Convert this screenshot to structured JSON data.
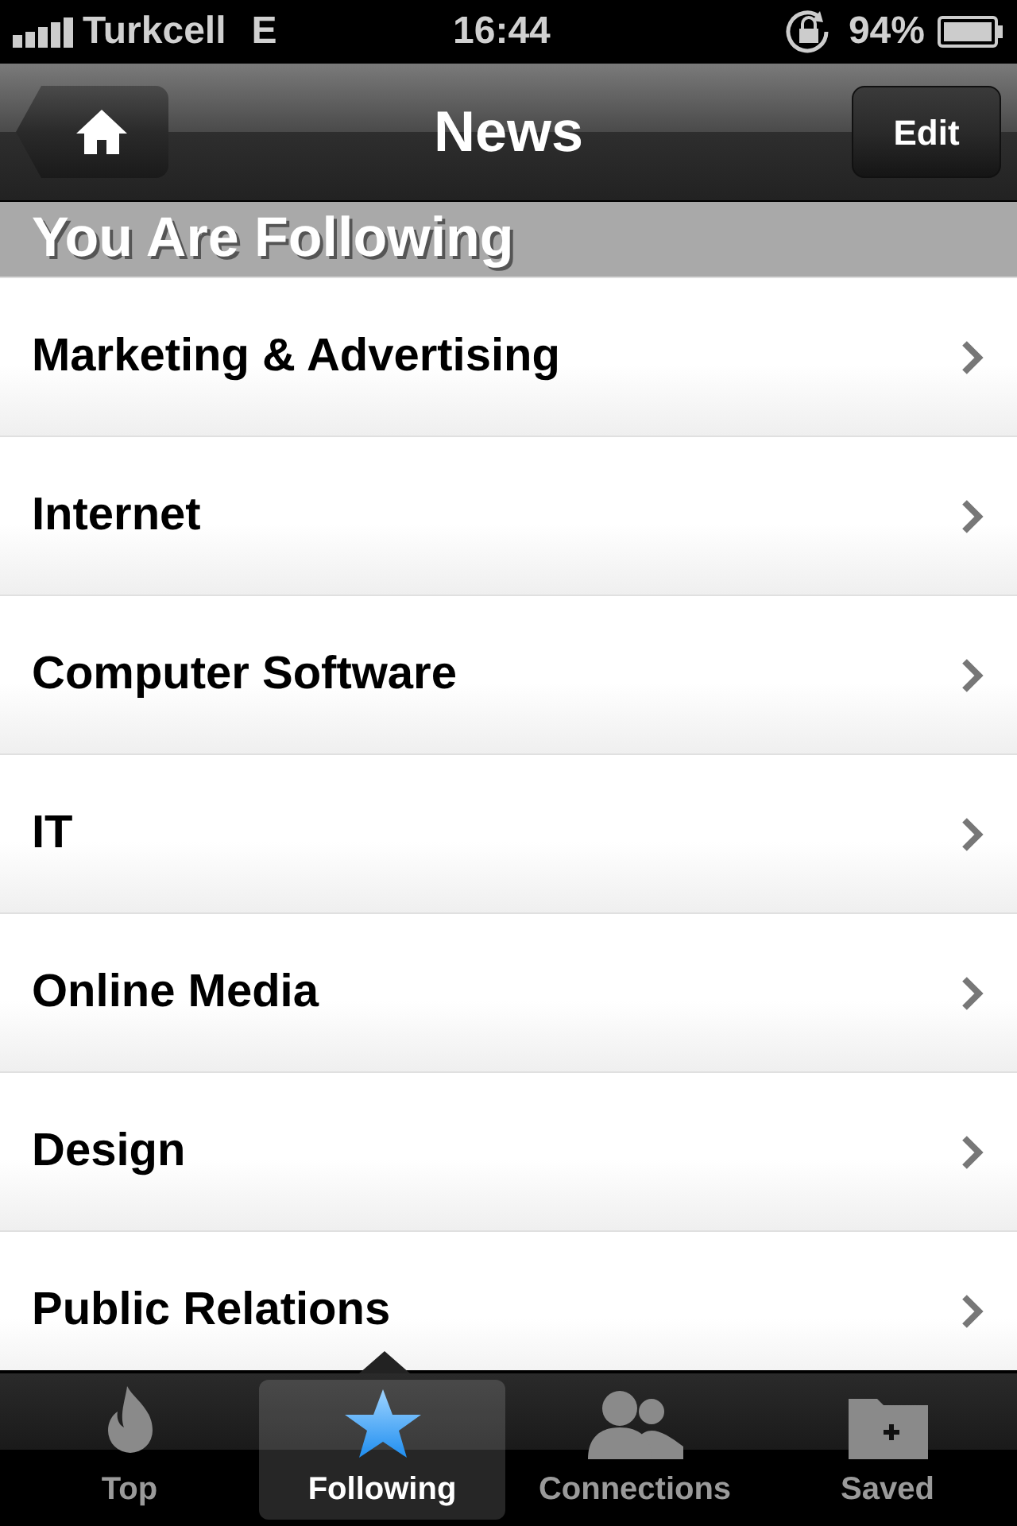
{
  "status_bar": {
    "carrier": "Turkcell",
    "network": "E",
    "time": "16:44",
    "battery": "94%"
  },
  "nav_bar": {
    "title": "News",
    "right_button": "Edit"
  },
  "section_header": "You Are Following",
  "items": [
    {
      "label": "Marketing & Advertising"
    },
    {
      "label": "Internet"
    },
    {
      "label": "Computer Software"
    },
    {
      "label": "IT"
    },
    {
      "label": "Online Media"
    },
    {
      "label": "Design"
    },
    {
      "label": "Public Relations"
    }
  ],
  "tabs": [
    {
      "label": "Top",
      "kind": "flame",
      "selected": false
    },
    {
      "label": "Following",
      "kind": "star",
      "selected": true
    },
    {
      "label": "Connections",
      "kind": "people",
      "selected": false
    },
    {
      "label": "Saved",
      "kind": "folder",
      "selected": false
    }
  ]
}
